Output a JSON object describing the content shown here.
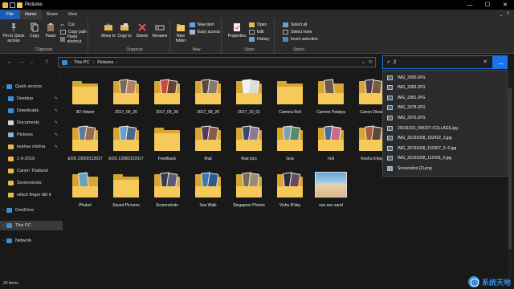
{
  "window": {
    "title": "Pictures",
    "buttons": {
      "minimize": "—",
      "maximize": "☐",
      "close": "✕"
    }
  },
  "tabs": [
    {
      "label": "File"
    },
    {
      "label": "Home"
    },
    {
      "label": "Share"
    },
    {
      "label": "View"
    }
  ],
  "ribbon": {
    "clipboard": {
      "group_label": "Clipboard",
      "pin": "Pin to Quick access",
      "copy": "Copy",
      "paste": "Paste",
      "cut": "Cut",
      "copy_path": "Copy path",
      "paste_shortcut": "Paste shortcut"
    },
    "organize": {
      "group_label": "Organize",
      "move_to": "Move to",
      "copy_to": "Copy to",
      "delete": "Delete",
      "rename": "Rename"
    },
    "new": {
      "group_label": "New",
      "new_folder": "New folder",
      "new_item": "New item",
      "easy_access": "Easy access"
    },
    "open": {
      "group_label": "Open",
      "properties": "Properties",
      "open": "Open",
      "edit": "Edit",
      "history": "History"
    },
    "select": {
      "group_label": "Select",
      "select_all": "Select all",
      "select_none": "Select none",
      "invert": "Invert selection"
    }
  },
  "address": {
    "crumbs": [
      "This PC",
      "Pictures"
    ]
  },
  "search": {
    "value": "2",
    "suggestions": [
      {
        "name": "IMG_2990.JPG",
        "type": "jpg"
      },
      {
        "name": "IMG_2983.JPG",
        "type": "jpg"
      },
      {
        "name": "IMG_2981.JPG",
        "type": "jpg"
      },
      {
        "name": "IMG_2978.JPG",
        "type": "jpg"
      },
      {
        "name": "IMG_2975.JPG",
        "type": "jpg"
      },
      {
        "name": "20191010_095227-COLLAGE.jpg",
        "type": "jpg"
      },
      {
        "name": "IMG_20191008_182422_3.jpg",
        "type": "jpg"
      },
      {
        "name": "IMG_20191008_150307_2~2.jpg",
        "type": "jpg"
      },
      {
        "name": "IMG_20191008_112435_2.jpg",
        "type": "jpg"
      },
      {
        "name": "Screenshot (2).png",
        "type": "png"
      }
    ]
  },
  "sidebar": {
    "items": [
      {
        "label": "Quick access",
        "icon": "star-icon",
        "color": "#3b8fd4",
        "pinned": false,
        "level": 0
      },
      {
        "label": "Desktop",
        "icon": "desktop-icon",
        "color": "#3b8fd4",
        "pinned": true,
        "level": 1
      },
      {
        "label": "Downloads",
        "icon": "download-icon",
        "color": "#3b8fd4",
        "pinned": true,
        "level": 1
      },
      {
        "label": "Documents",
        "icon": "document-icon",
        "color": "#cfd6e0",
        "pinned": true,
        "level": 1
      },
      {
        "label": "Pictures",
        "icon": "pictures-icon",
        "color": "#8fb3d9",
        "pinned": true,
        "level": 1
      },
      {
        "label": "keshav mishra",
        "icon": "folder-icon",
        "color": "#e8b94a",
        "pinned": true,
        "level": 1
      },
      {
        "label": "1-9-2019",
        "icon": "folder-icon",
        "color": "#e8b94a",
        "pinned": false,
        "level": 1
      },
      {
        "label": "Canon Thailand",
        "icon": "folder-icon",
        "color": "#e8b94a",
        "pinned": false,
        "level": 1
      },
      {
        "label": "Screenshots",
        "icon": "folder-icon",
        "color": "#e8b94a",
        "pinned": false,
        "level": 1
      },
      {
        "label": "which finger did it",
        "icon": "folder-icon",
        "color": "#e8b94a",
        "pinned": false,
        "level": 1
      },
      {
        "label": "OneDrive",
        "icon": "cloud-icon",
        "color": "#3b8fd4",
        "pinned": false,
        "level": 0
      },
      {
        "label": "This PC",
        "icon": "computer-icon",
        "color": "#3b8fd4",
        "pinned": false,
        "level": 0
      },
      {
        "label": "Network",
        "icon": "network-icon",
        "color": "#3b8fd4",
        "pinned": false,
        "level": 0
      }
    ],
    "pin_glyph": "✎"
  },
  "files": [
    {
      "label": "3D Viewer",
      "kind": "folder",
      "photos": []
    },
    {
      "label": "2017_09_25",
      "kind": "folder",
      "photos": [
        "#7a6a55",
        "#b08060"
      ]
    },
    {
      "label": "2017_09_28",
      "kind": "folder",
      "photos": [
        "#c84a3a",
        "#6a4030"
      ]
    },
    {
      "label": "2017_09_29",
      "kind": "folder",
      "photos": [
        "#5a4a3a",
        "#8a7a6a"
      ]
    },
    {
      "label": "2017_10_01",
      "kind": "folder",
      "photos": [
        "#f2f2f2",
        "#dddddd"
      ]
    },
    {
      "label": "Camera Roll",
      "kind": "folder",
      "photos": []
    },
    {
      "label": "Cannon Patatya",
      "kind": "folder",
      "photos": [
        "#6a5a4a"
      ]
    },
    {
      "label": "Canon Diwali",
      "kind": "folder",
      "photos": [
        "#4a3a4a",
        "#7a5a3a"
      ]
    },
    {
      "label": "EOS 1300D112017",
      "kind": "folder",
      "photos": [
        "#5a7a9a",
        "#9a6a4a"
      ]
    },
    {
      "label": "EOS 1300D122017",
      "kind": "folder",
      "photos": [
        "#6aa0c8",
        "#4a6a8a"
      ]
    },
    {
      "label": "Feedback",
      "kind": "folder",
      "photos": []
    },
    {
      "label": "final",
      "kind": "folder",
      "photos": [
        "#5a3a5a",
        "#8a5a4a"
      ]
    },
    {
      "label": "final pics",
      "kind": "folder",
      "photos": [
        "#3a4a6a",
        "#8a7a9a"
      ]
    },
    {
      "label": "Goa",
      "kind": "folder",
      "photos": [
        "#7aa0b8",
        "#5a8a6a"
      ]
    },
    {
      "label": "holi",
      "kind": "folder",
      "photos": [
        "#4a6a9a",
        "#c86a8a"
      ]
    },
    {
      "label": "Keshu b'day",
      "kind": "folder",
      "photos": [
        "#a85a3a",
        "#5a4a3a"
      ]
    },
    {
      "label": "Phuket",
      "kind": "folder",
      "photos": [
        "#6aa0c0"
      ]
    },
    {
      "label": "Saved Pictures",
      "kind": "folder",
      "photos": []
    },
    {
      "label": "Screenshots",
      "kind": "folder",
      "photos": [
        "#3a3a4a",
        "#5a5a7a"
      ]
    },
    {
      "label": "Sea Walk",
      "kind": "folder",
      "photos": [
        "#3a7ab0",
        "#2a5a8a"
      ]
    },
    {
      "label": "Singapore Photos",
      "kind": "folder",
      "photos": [
        "#7a6a5a",
        "#9a8a7a"
      ]
    },
    {
      "label": "Vishu B'day",
      "kind": "folder",
      "photos": [
        "#2a2a3a",
        "#6a4a5a"
      ]
    },
    {
      "label": "sun ans sand",
      "kind": "image",
      "photos": []
    }
  ],
  "status": {
    "text": "29 items"
  },
  "watermark": {
    "text": "系统天地"
  },
  "colors": {
    "accent": "#1a73e8",
    "folder": "#f5ca5a",
    "folder_back": "#d9a531",
    "background": "#191919"
  }
}
